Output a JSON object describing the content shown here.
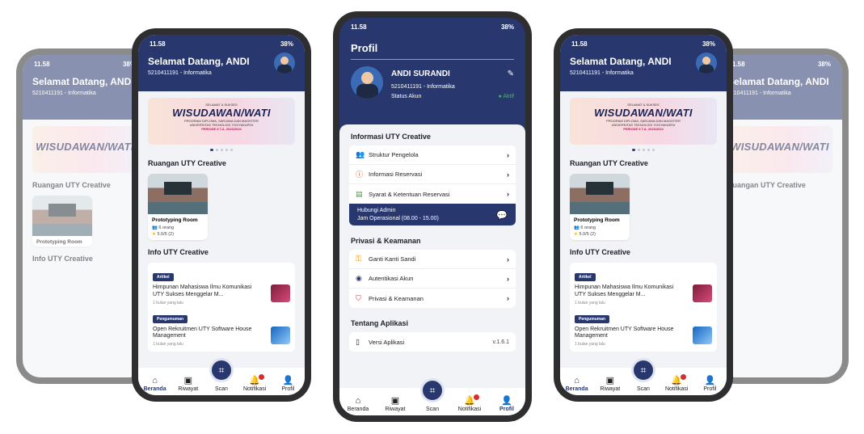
{
  "status": {
    "time": "11.58",
    "battery": "38%"
  },
  "home": {
    "greeting": "Selamat Datang, ANDI",
    "nim": "5210411191 - Informatika",
    "banner": {
      "kicker": "SELAMAT & SUKSES",
      "title": "WISUDAWAN/WATI",
      "line1": "PROGRAM DIPLOMA, SARJANA DAN MAGISTER",
      "line2": "UNIVERSITAS TEKNOLOGI YOGYAKARTA",
      "line3": "PERIODE II T.A. 2023/2024"
    },
    "rooms_title": "Ruangan UTY Creative",
    "room": {
      "name": "Prototyping Room",
      "capacity": "6 orang",
      "rating": "5.0/5 (2)"
    },
    "info_title": "Info UTY Creative",
    "info": [
      {
        "tag": "Artikel",
        "title": "Himpunan Mahasiswa Ilmu Komunikasi UTY Sukses Menggelar M...",
        "time": "1 bulan yang lalu"
      },
      {
        "tag": "Pengumuman",
        "title": "Open Rekruitmen UTY Software House Management",
        "time": "1 bulan yang lalu"
      }
    ]
  },
  "nav": {
    "home": "Beranda",
    "history": "Riwayat",
    "scan": "Scan",
    "notif": "Notifikasi",
    "profile": "Profil"
  },
  "profile": {
    "title": "Profil",
    "name": "ANDI SURANDI",
    "nim": "5210411191 - Informatika",
    "status_label": "Status Akun",
    "status_value": "Aktif",
    "sec_info": "Informasi UTY Creative",
    "info_items": [
      "Struktur Pengelola",
      "Informasi Reservasi",
      "Syarat & Ketentuan Reservasi"
    ],
    "contact_title": "Hubungi Admin",
    "contact_hours": "Jam Operasional (08.00 - 15.00)",
    "sec_privacy": "Privasi & Keamanan",
    "privacy_items": [
      "Ganti Kanti Sandi",
      "Autentikasi Akun",
      "Privasi & Keamanan"
    ],
    "sec_about": "Tentang Aplikasi",
    "version_label": "Versi Aplikasi",
    "version_value": "v.1.6.1"
  },
  "colors": {
    "navy": "#28386e",
    "active": "#35c24a",
    "badge": "#d32f2f"
  }
}
